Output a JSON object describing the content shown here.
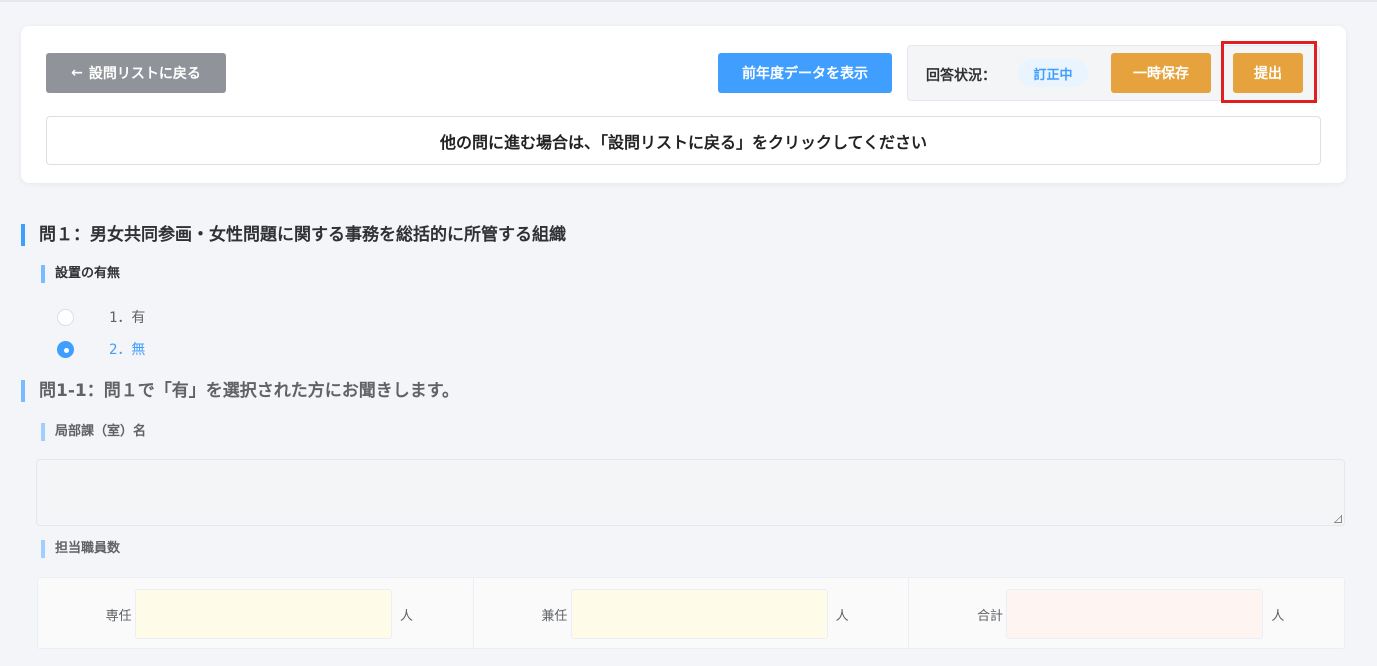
{
  "header": {
    "back_label": "設問リストに戻る",
    "back_icon": "arrow-left-icon",
    "prev_year_label": "前年度データを表示",
    "status_label": "回答状況：",
    "status_value": "訂正中",
    "save_label": "一時保存",
    "submit_label": "提出",
    "notice": "他の問に進む場合は、「設問リストに戻る」をクリックしてください"
  },
  "question1": {
    "title": "問１：男女共同参画・女性問題に関する事務を総括的に所管する組織",
    "subtitle": "設置の有無",
    "options": [
      {
        "label": "1．有",
        "selected": false
      },
      {
        "label": "2．無",
        "selected": true
      }
    ]
  },
  "question1_1": {
    "title": "問1-1：問１で「有」を選択された方にお聞きします。",
    "dept_label": "局部課（室）名",
    "dept_value": "",
    "staff_label": "担当職員数",
    "staff": [
      {
        "label": "専任",
        "value": "",
        "unit": "人"
      },
      {
        "label": "兼任",
        "value": "",
        "unit": "人"
      },
      {
        "label": "合計",
        "value": "",
        "unit": "人"
      }
    ]
  },
  "colors": {
    "primary": "#409eff",
    "warning": "#e6a23c",
    "info": "#909399",
    "highlight": "#e02020"
  }
}
